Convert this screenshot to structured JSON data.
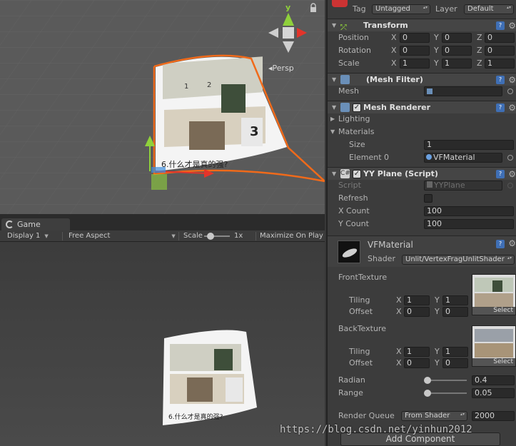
{
  "scene": {
    "projection_label": "Persp",
    "gizmo_axis_label": "y",
    "page_caption": "6.什么才是真的强?",
    "page_numbers": [
      "1",
      "2",
      "3"
    ]
  },
  "game": {
    "tab_label": "Game",
    "display_label": "Display 1",
    "aspect_label": "Free Aspect",
    "scale_label": "Scale",
    "scale_value": "1x",
    "maximize_label": "Maximize On Play",
    "page_caption": "6.什么才是真的强?"
  },
  "inspector": {
    "tag_label": "Tag",
    "tag_value": "Untagged",
    "layer_label": "Layer",
    "layer_value": "Default",
    "transform": {
      "title": "Transform",
      "rows": [
        {
          "label": "Position",
          "x": "0",
          "y": "0",
          "z": "0"
        },
        {
          "label": "Rotation",
          "x": "0",
          "y": "0",
          "z": "0"
        },
        {
          "label": "Scale",
          "x": "1",
          "y": "1",
          "z": "1"
        }
      ],
      "axis_x": "X",
      "axis_y": "Y",
      "axis_z": "Z"
    },
    "mesh_filter": {
      "title": "(Mesh Filter)",
      "mesh_label": "Mesh"
    },
    "mesh_renderer": {
      "title": "Mesh Renderer",
      "lighting_label": "Lighting",
      "materials_label": "Materials",
      "size_label": "Size",
      "size_value": "1",
      "element_label": "Element 0",
      "element_value": "VFMaterial"
    },
    "yy_plane": {
      "title": "YY Plane (Script)",
      "script_label": "Script",
      "script_value": "YYPlane",
      "refresh_label": "Refresh",
      "xcount_label": "X Count",
      "xcount_value": "100",
      "ycount_label": "Y Count",
      "ycount_value": "100"
    },
    "material": {
      "name": "VFMaterial",
      "shader_label": "Shader",
      "shader_value": "Unlit/VertexFragUnlitShader",
      "front_texture_label": "FrontTexture",
      "back_texture_label": "BackTexture",
      "tiling_label": "Tiling",
      "offset_label": "Offset",
      "front_tiling_x": "1",
      "front_tiling_y": "1",
      "front_offset_x": "0",
      "front_offset_y": "0",
      "back_tiling_x": "1",
      "back_tiling_y": "1",
      "back_offset_x": "0",
      "back_offset_y": "0",
      "select_label": "Select",
      "radian_label": "Radian",
      "radian_value": "0.4",
      "radian_level": 0.05,
      "range_label": "Range",
      "range_value": "0.05",
      "range_level": 0.05,
      "render_queue_label": "Render Queue",
      "render_queue_mode": "From Shader",
      "render_queue_value": "2000"
    },
    "add_component_label": "Add Component"
  },
  "watermark": "https://blog.csdn.net/yinhun2012",
  "colors": {
    "scene_bg": "#5a5a5a",
    "selection_outline": "#f06a1a",
    "gizmo_y": "#8fd13b",
    "gizmo_x": "#e3342a",
    "gizmo_z": "#3d8fe0",
    "inspector_bg": "#3c3c3c"
  }
}
